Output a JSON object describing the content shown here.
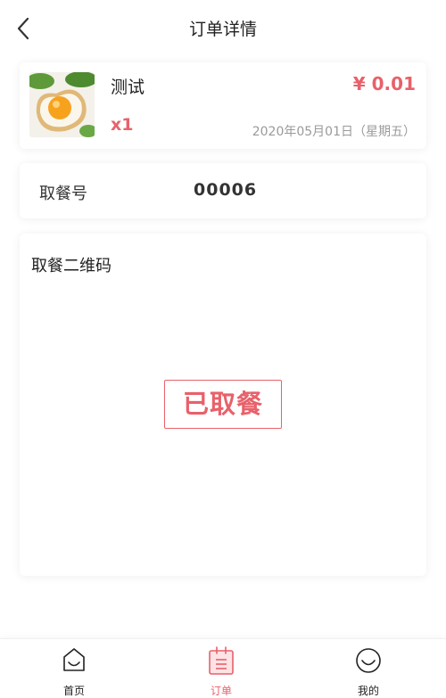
{
  "header": {
    "title": "订单详情"
  },
  "order": {
    "product_name": "测试",
    "price": "¥ 0.01",
    "quantity": "x1",
    "date": "2020年05月01日（星期五）"
  },
  "pickup": {
    "label": "取餐号",
    "number": "00006"
  },
  "qr_section": {
    "title": "取餐二维码",
    "stamp_text": "已取餐"
  },
  "tabbar": {
    "items": [
      {
        "label": "首页",
        "icon": "home-icon",
        "active": false
      },
      {
        "label": "订单",
        "icon": "order-icon",
        "active": true
      },
      {
        "label": "我的",
        "icon": "smile-icon",
        "active": false
      }
    ]
  },
  "colors": {
    "accent": "#e8616a",
    "text": "#222222",
    "muted": "#9a9a9a"
  }
}
